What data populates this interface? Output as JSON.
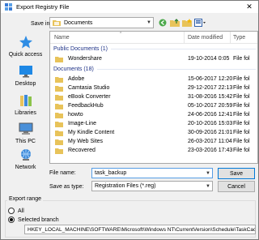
{
  "window": {
    "title": "Export Registry File",
    "close_glyph": "✕"
  },
  "savein": {
    "label": "Save in:",
    "value": "Documents"
  },
  "places": [
    {
      "key": "quick-access",
      "label": "Quick access"
    },
    {
      "key": "desktop",
      "label": "Desktop"
    },
    {
      "key": "libraries",
      "label": "Libraries"
    },
    {
      "key": "this-pc",
      "label": "This PC"
    },
    {
      "key": "network",
      "label": "Network"
    }
  ],
  "list": {
    "columns": {
      "name": "Name",
      "date": "Date modified",
      "type": "Type"
    },
    "groups": {
      "public": "Public Documents (1)",
      "documents": "Documents (18)"
    },
    "public_items": [
      {
        "name": "Wondershare",
        "date": "19-10-2014 0:05",
        "type": "File fol"
      }
    ],
    "items": [
      {
        "name": "Adobe",
        "date": "15-06-2017 12:20",
        "type": "File fol"
      },
      {
        "name": "Camtasia Studio",
        "date": "29-12-2017 22:13",
        "type": "File fol"
      },
      {
        "name": "eBook Converter",
        "date": "31-08-2016 15:42",
        "type": "File fol"
      },
      {
        "name": "FeedbackHub",
        "date": "05-10-2017 20:59",
        "type": "File fol"
      },
      {
        "name": "howto",
        "date": "24-06-2016 12:41",
        "type": "File fol"
      },
      {
        "name": "Image-Line",
        "date": "20-10-2016 15:03",
        "type": "File fol"
      },
      {
        "name": "My Kindle Content",
        "date": "30-09-2016 21:01",
        "type": "File fol"
      },
      {
        "name": "My Web Sites",
        "date": "26-03-2017 11:04",
        "type": "File fol"
      },
      {
        "name": "Recovered",
        "date": "23-03-2016 17:43",
        "type": "File fol"
      }
    ]
  },
  "filename": {
    "label": "File name:",
    "value": "task_backup"
  },
  "filetype": {
    "label": "Save as type:",
    "value": "Registration Files (*.reg)"
  },
  "buttons": {
    "save": "Save",
    "cancel": "Cancel"
  },
  "export_range": {
    "legend": "Export range",
    "all": "All",
    "selected": "Selected branch",
    "selected_checked": true,
    "branch_path": "HKEY_LOCAL_MACHINE\\SOFTWARE\\Microsoft\\Windows NT\\CurrentVersion\\Schedule\\TaskCache"
  },
  "colors": {
    "folder": "#e8c35a",
    "accent": "#0078d7",
    "group_header": "#1e3287"
  }
}
